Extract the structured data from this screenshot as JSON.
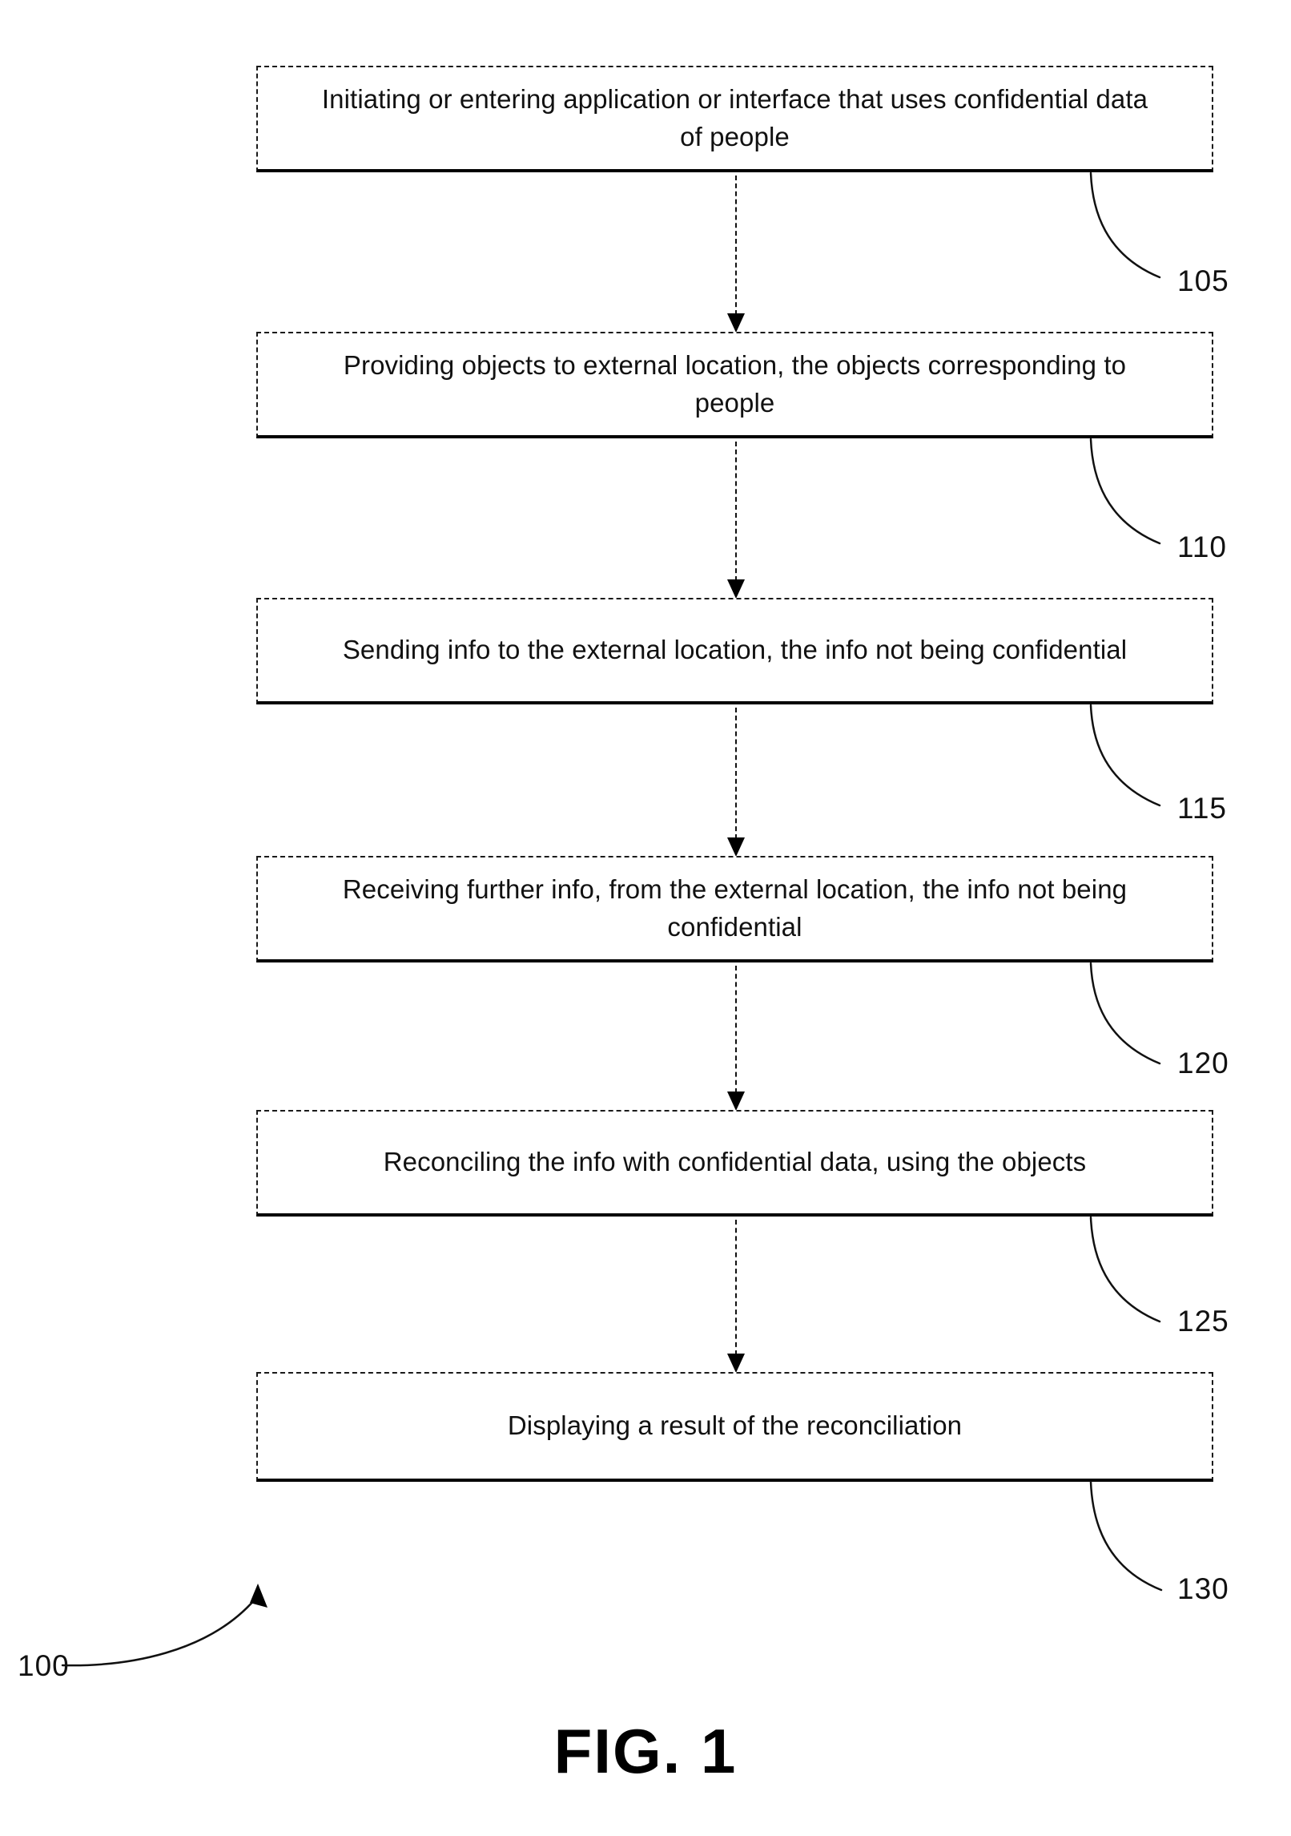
{
  "figure": {
    "caption": "FIG. 1",
    "diagram_id": "100"
  },
  "flowchart": {
    "type": "patent-flowchart",
    "orientation": "vertical",
    "steps": [
      {
        "id": "105",
        "text": "Initiating or entering application or interface that uses confidential data of people",
        "ref_label": "105"
      },
      {
        "id": "110",
        "text": "Providing objects to external location, the objects corresponding to people",
        "ref_label": "110"
      },
      {
        "id": "115",
        "text": "Sending info to the external location, the info not being confidential",
        "ref_label": "115"
      },
      {
        "id": "120",
        "text": "Receiving further info, from the external location, the info not being confidential",
        "ref_label": "120"
      },
      {
        "id": "125",
        "text": "Reconciling the info with confidential data, using the objects",
        "ref_label": "125"
      },
      {
        "id": "130",
        "text": "Displaying a result of the reconciliation",
        "ref_label": "130"
      }
    ]
  },
  "colors": {
    "ink": "#111111",
    "background": "#ffffff"
  }
}
